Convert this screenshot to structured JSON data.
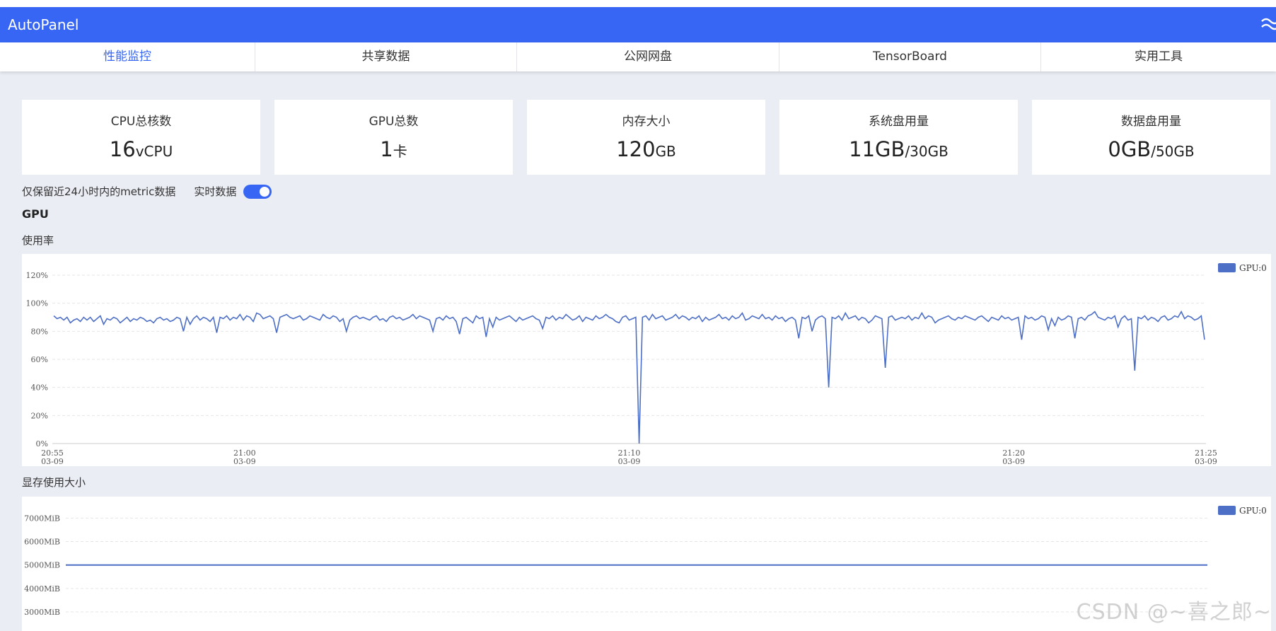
{
  "app": {
    "title": "AutoPanel",
    "menu_icon": "wave-menu-icon"
  },
  "tabs": [
    {
      "label": "性能监控",
      "active": true
    },
    {
      "label": "共享数据",
      "active": false
    },
    {
      "label": "公网网盘",
      "active": false
    },
    {
      "label": "TensorBoard",
      "active": false
    },
    {
      "label": "实用工具",
      "active": false
    }
  ],
  "cards": [
    {
      "title": "CPU总核数",
      "value": "16",
      "unit": "vCPU"
    },
    {
      "title": "GPU总数",
      "value": "1",
      "unit": "卡"
    },
    {
      "title": "内存大小",
      "value": "120",
      "unit": "GB"
    },
    {
      "title": "系统盘用量",
      "value": "11GB",
      "unit": "/30GB"
    },
    {
      "title": "数据盘用量",
      "value": "0GB",
      "unit": "/50GB"
    }
  ],
  "controls": {
    "retention_note": "仅保留近24小时内的metric数据",
    "realtime_label": "实时数据",
    "realtime_on": true
  },
  "section": {
    "title": "GPU"
  },
  "charts": {
    "usage_title": "使用率",
    "memory_title": "显存使用大小"
  },
  "watermark": "CSDN @~喜之郎~",
  "colors": {
    "accent": "#3766f4",
    "series": "#4e6fc6",
    "background": "#eaedf4"
  },
  "chart_data": [
    {
      "type": "line",
      "title": "使用率",
      "y_ticks": [
        "0%",
        "20%",
        "40%",
        "60%",
        "80%",
        "100%",
        "120%"
      ],
      "ylim": [
        0,
        120
      ],
      "x_ticks": [
        {
          "t": 0,
          "time": "20:55",
          "date": "03-09"
        },
        {
          "t": 5,
          "time": "21:00",
          "date": "03-09"
        },
        {
          "t": 15,
          "time": "21:10",
          "date": "03-09"
        },
        {
          "t": 25,
          "time": "21:20",
          "date": "03-09"
        },
        {
          "t": 30,
          "time": "21:25",
          "date": "03-09"
        }
      ],
      "grid": true,
      "legend": "top-right",
      "series": [
        {
          "name": "GPU:0",
          "x_start": "20:55",
          "x_end": "21:25",
          "values": [
            91,
            89,
            90,
            88,
            90,
            86,
            88,
            89,
            87,
            90,
            88,
            90,
            87,
            89,
            91,
            85,
            89,
            88,
            90,
            89,
            86,
            88,
            90,
            87,
            89,
            88,
            90,
            89,
            87,
            88,
            86,
            89,
            90,
            88,
            89,
            87,
            88,
            90,
            89,
            80,
            90,
            85,
            89,
            91,
            88,
            90,
            89,
            87,
            90,
            79,
            90,
            89,
            91,
            88,
            90,
            89,
            92,
            88,
            91,
            90,
            87,
            93,
            92,
            89,
            90,
            91,
            89,
            79,
            90,
            91,
            92,
            90,
            89,
            90,
            91,
            88,
            89,
            91,
            90,
            89,
            88,
            92,
            90,
            89,
            91,
            90,
            87,
            89,
            80,
            88,
            90,
            91,
            89,
            90,
            89,
            88,
            90,
            91,
            88,
            89,
            87,
            90,
            91,
            89,
            90,
            88,
            89,
            90,
            92,
            89,
            91,
            90,
            89,
            88,
            80,
            89,
            90,
            88,
            91,
            89,
            90,
            87,
            78,
            89,
            90,
            88,
            86,
            91,
            89,
            90,
            76,
            89,
            83,
            90,
            88,
            89,
            90,
            91,
            89,
            87,
            90,
            88,
            89,
            90,
            91,
            89,
            88,
            82,
            90,
            89,
            91,
            88,
            90,
            89,
            92,
            90,
            88,
            89,
            91,
            87,
            90,
            89,
            88,
            91,
            89,
            90,
            92,
            90,
            89,
            87,
            86,
            90,
            91,
            88,
            89,
            90,
            0,
            90,
            91,
            88,
            92,
            89,
            90,
            91,
            88,
            89,
            90,
            92,
            89,
            91,
            90,
            88,
            90,
            89,
            91,
            87,
            90,
            88,
            89,
            90,
            92,
            89,
            90,
            88,
            91,
            89,
            90,
            93,
            88,
            89,
            91,
            90,
            89,
            92,
            89,
            90,
            88,
            91,
            89,
            90,
            87,
            89,
            90,
            88,
            75,
            90,
            89,
            91,
            80,
            88,
            90,
            91,
            89,
            40,
            90,
            89,
            91,
            88,
            93,
            89,
            90,
            91,
            88,
            90,
            89,
            86,
            88,
            91,
            90,
            89,
            54,
            90,
            91,
            88,
            89,
            90,
            89,
            91,
            88,
            90,
            89,
            93,
            89,
            91,
            90,
            86,
            88,
            89,
            90,
            91,
            89,
            88,
            90,
            89,
            91,
            90,
            89,
            88,
            90,
            91,
            89,
            87,
            90,
            89,
            88,
            91,
            89,
            90,
            88,
            89,
            90,
            74,
            91,
            89,
            90,
            88,
            89,
            91,
            90,
            81,
            89,
            84,
            90,
            88,
            89,
            91,
            90,
            75,
            89,
            90,
            88,
            91,
            92,
            94,
            90,
            89,
            88,
            90,
            89,
            91,
            83,
            89,
            91,
            88,
            89,
            52,
            90,
            89,
            91,
            88,
            90,
            89,
            87,
            90,
            91,
            88,
            89,
            91,
            90,
            94,
            89,
            91,
            90,
            88,
            89,
            91,
            74
          ]
        }
      ]
    },
    {
      "type": "line",
      "title": "显存使用大小",
      "y_ticks": [
        "3000MiB",
        "4000MiB",
        "5000MiB",
        "6000MiB",
        "7000MiB"
      ],
      "ylim": [
        3000,
        7000
      ],
      "grid": true,
      "legend": "top-right",
      "series": [
        {
          "name": "GPU:0",
          "values": [
            5000,
            5000
          ]
        }
      ]
    }
  ]
}
